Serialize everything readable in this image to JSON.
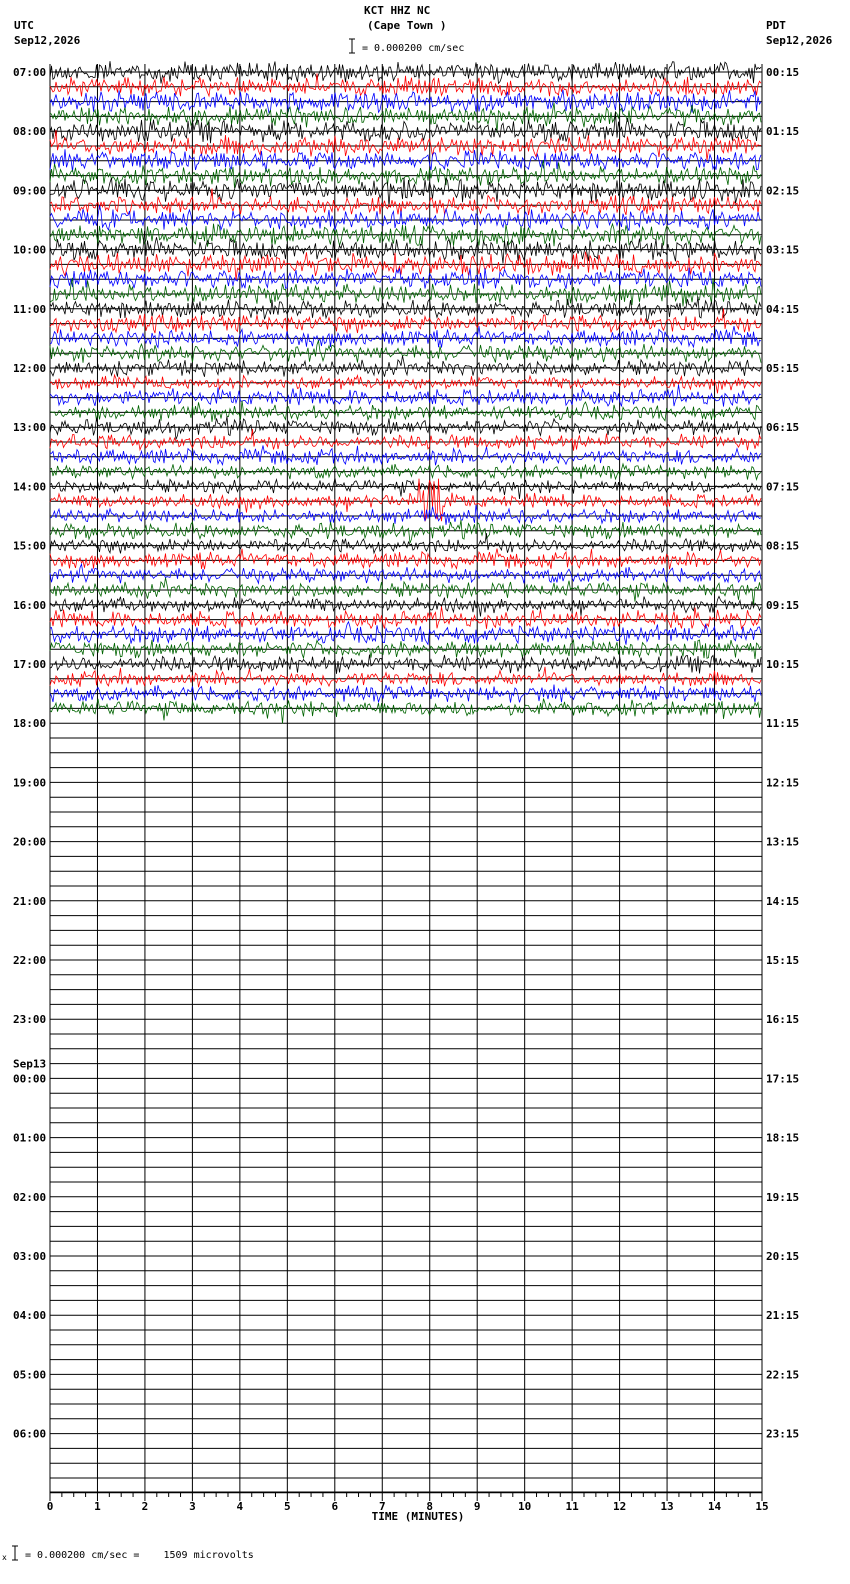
{
  "header": {
    "station": "KCT HHZ NC",
    "location": "(Cape Town )",
    "scale_text": "= 0.000200 cm/sec",
    "left_tz": "UTC",
    "left_date": "Sep12,2026",
    "right_tz": "PDT",
    "right_date": "Sep12,2026"
  },
  "footer": {
    "scale_text": "= 0.000200 cm/sec =    1509 microvolts"
  },
  "chart_data": {
    "type": "line",
    "title": "KCT HHZ NC (Cape Town )",
    "xlabel": "TIME (MINUTES)",
    "xlim": [
      0,
      15
    ],
    "x_ticks": [
      "0",
      "1",
      "2",
      "3",
      "4",
      "5",
      "6",
      "7",
      "8",
      "9",
      "10",
      "11",
      "12",
      "13",
      "14",
      "15"
    ],
    "trace_colors": [
      "#000000",
      "#ff0000",
      "#0000ff",
      "#006400"
    ],
    "traces_per_hour": 4,
    "total_rows": 96,
    "rows_with_signal": 44,
    "left_labels_utc": [
      "07:00",
      "08:00",
      "09:00",
      "10:00",
      "11:00",
      "12:00",
      "13:00",
      "14:00",
      "15:00",
      "16:00",
      "17:00",
      "18:00",
      "19:00",
      "20:00",
      "21:00",
      "22:00",
      "23:00",
      "00:00",
      "01:00",
      "02:00",
      "03:00",
      "04:00",
      "05:00",
      "06:00"
    ],
    "left_date_change": {
      "hour_index": 17,
      "label": "Sep13"
    },
    "right_labels_pdt": [
      "00:15",
      "01:15",
      "02:15",
      "03:15",
      "04:15",
      "05:15",
      "06:15",
      "07:15",
      "08:15",
      "09:15",
      "10:15",
      "11:15",
      "12:15",
      "13:15",
      "14:15",
      "15:15",
      "16:15",
      "17:15",
      "18:15",
      "19:15",
      "20:15",
      "21:15",
      "22:15",
      "23:15"
    ],
    "event": {
      "utc_hour": "14:00",
      "trace": 1,
      "minute": 8.0
    }
  }
}
